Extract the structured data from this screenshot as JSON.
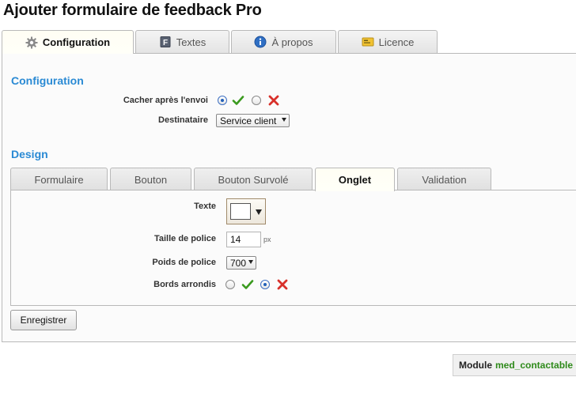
{
  "page": {
    "title": "Ajouter formulaire de feedback Pro"
  },
  "top_tabs": [
    {
      "label": "Configuration",
      "icon": "gear-icon",
      "active": true
    },
    {
      "label": "Textes",
      "icon": "f-document-icon",
      "active": false
    },
    {
      "label": "À propos",
      "icon": "info-icon",
      "active": false
    },
    {
      "label": "Licence",
      "icon": "license-card-icon",
      "active": false
    }
  ],
  "configuration": {
    "section_title": "Configuration",
    "hide_after_send": {
      "label": "Cacher après l'envoi",
      "value": "yes"
    },
    "recipient": {
      "label": "Destinataire",
      "value": "Service client"
    }
  },
  "design": {
    "section_title": "Design",
    "tabs": [
      {
        "label": "Formulaire",
        "active": false
      },
      {
        "label": "Bouton",
        "active": false
      },
      {
        "label": "Bouton Survolé",
        "active": false
      },
      {
        "label": "Onglet",
        "active": true
      },
      {
        "label": "Validation",
        "active": false
      }
    ],
    "text_color": {
      "label": "Texte",
      "value": "#ffffff"
    },
    "font_size": {
      "label": "Taille de police",
      "value": "14",
      "unit": "px"
    },
    "font_weight": {
      "label": "Poids de police",
      "value": "700"
    },
    "rounded_borders": {
      "label": "Bords arrondis",
      "value": "no"
    }
  },
  "actions": {
    "save_label": "Enregistrer"
  },
  "footer": {
    "module_prefix": "Module",
    "module_name": "med_contactable"
  },
  "colors": {
    "accent": "#2a8ad4",
    "check": "#3a9a1e",
    "cross": "#d8302a",
    "module_name": "#2e8a1a"
  }
}
